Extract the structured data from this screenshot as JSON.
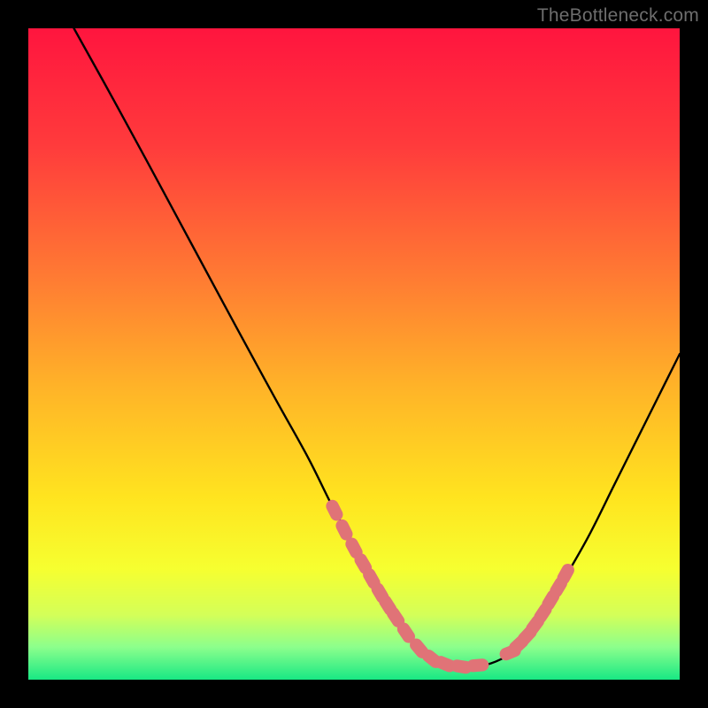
{
  "watermark": "TheBottleneck.com",
  "chart_data": {
    "type": "line",
    "title": "",
    "xlabel": "",
    "ylabel": "",
    "xlim": [
      0,
      100
    ],
    "ylim": [
      0,
      100
    ],
    "grid": false,
    "legend": false,
    "gradient_stops": [
      {
        "offset": 0.0,
        "color": "#ff153e"
      },
      {
        "offset": 0.18,
        "color": "#ff3b3c"
      },
      {
        "offset": 0.38,
        "color": "#ff7a33"
      },
      {
        "offset": 0.55,
        "color": "#ffb328"
      },
      {
        "offset": 0.72,
        "color": "#ffe41f"
      },
      {
        "offset": 0.83,
        "color": "#f6ff30"
      },
      {
        "offset": 0.9,
        "color": "#d4ff58"
      },
      {
        "offset": 0.95,
        "color": "#8cff8c"
      },
      {
        "offset": 1.0,
        "color": "#18e884"
      }
    ],
    "series": [
      {
        "name": "bottleneck-curve",
        "color": "#000000",
        "x": [
          7,
          12,
          18,
          25,
          32,
          38,
          43,
          47,
          51,
          54,
          56.5,
          59,
          62,
          65,
          68,
          71,
          74,
          76,
          79,
          82,
          86,
          90,
          94,
          98,
          100
        ],
        "y": [
          100,
          91,
          80,
          67,
          54,
          43,
          34,
          26,
          19,
          13,
          9,
          5.5,
          3,
          2,
          2,
          2.5,
          4,
          6,
          10,
          15,
          22,
          30,
          38,
          46,
          50
        ]
      }
    ],
    "markers": {
      "name": "highlight-dots",
      "color": "#e07377",
      "radius": 1.3,
      "x": [
        47.0,
        48.5,
        50.0,
        51.4,
        52.7,
        54.0,
        55.2,
        56.4,
        58.0,
        60.0,
        62.0,
        64.0,
        66.5,
        69.0,
        74.0,
        75.3,
        76.6,
        77.8,
        79.0,
        80.2,
        81.4,
        82.5
      ],
      "y": [
        26.0,
        23.0,
        20.2,
        17.8,
        15.5,
        13.3,
        11.4,
        9.6,
        7.2,
        4.8,
        3.2,
        2.4,
        2.0,
        2.2,
        4.2,
        5.4,
        6.8,
        8.4,
        10.2,
        12.2,
        14.2,
        16.2
      ]
    }
  }
}
